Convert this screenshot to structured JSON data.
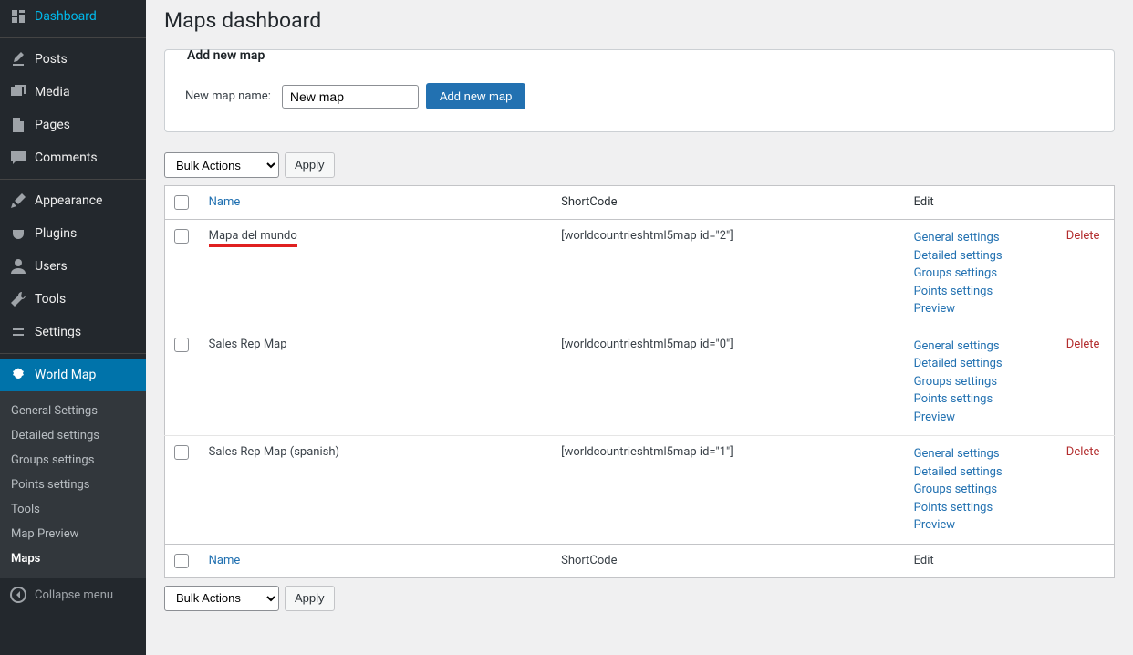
{
  "page_title": "Maps dashboard",
  "sidebar": {
    "items": [
      {
        "label": "Dashboard",
        "icon": "dashboard"
      },
      {
        "label": "Posts",
        "icon": "pin"
      },
      {
        "label": "Media",
        "icon": "media"
      },
      {
        "label": "Pages",
        "icon": "page"
      },
      {
        "label": "Comments",
        "icon": "comment"
      },
      {
        "label": "Appearance",
        "icon": "brush"
      },
      {
        "label": "Plugins",
        "icon": "plug"
      },
      {
        "label": "Users",
        "icon": "users"
      },
      {
        "label": "Tools",
        "icon": "tools"
      },
      {
        "label": "Settings",
        "icon": "settings"
      },
      {
        "label": "World Map",
        "icon": "gear",
        "active": true
      }
    ],
    "submenu": [
      "General Settings",
      "Detailed settings",
      "Groups settings",
      "Points settings",
      "Tools",
      "Map Preview",
      "Maps"
    ],
    "collapse": "Collapse menu"
  },
  "fieldset": {
    "legend": "Add new map",
    "label": "New map name:",
    "input_value": "New map",
    "button": "Add new map"
  },
  "bulk": {
    "select": "Bulk Actions",
    "apply": "Apply"
  },
  "table": {
    "head_name": "Name",
    "head_short": "ShortCode",
    "head_edit": "Edit",
    "rows": [
      {
        "name": "Mapa del mundo",
        "highlighted": true,
        "shortcode": "[worldcountrieshtml5map id=\"2\"]",
        "links": [
          "General settings",
          "Detailed settings",
          "Groups settings",
          "Points settings",
          "Preview"
        ],
        "delete": "Delete"
      },
      {
        "name": "Sales Rep Map",
        "highlighted": false,
        "shortcode": "[worldcountrieshtml5map id=\"0\"]",
        "links": [
          "General settings",
          "Detailed settings",
          "Groups settings",
          "Points settings",
          "Preview"
        ],
        "delete": "Delete"
      },
      {
        "name": "Sales Rep Map (spanish)",
        "highlighted": false,
        "shortcode": "[worldcountrieshtml5map id=\"1\"]",
        "links": [
          "General settings",
          "Detailed settings",
          "Groups settings",
          "Points settings",
          "Preview"
        ],
        "delete": "Delete"
      }
    ]
  }
}
